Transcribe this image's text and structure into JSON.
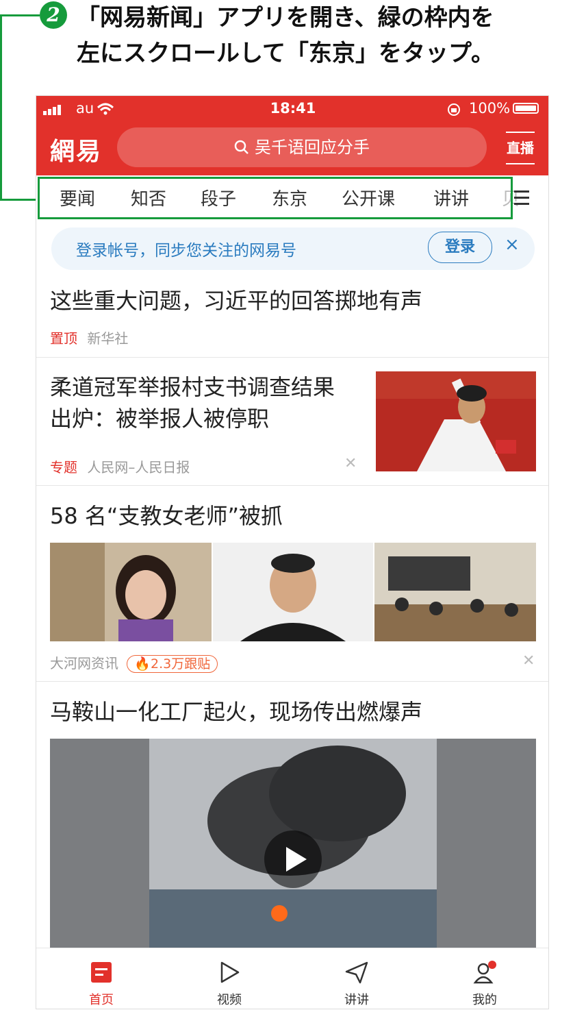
{
  "instruction": {
    "step": "2",
    "line1": "「网易新闻」アプリを開き、緑の枠内を",
    "line2": "左にスクロールして「东京」をタップ。"
  },
  "status_bar": {
    "carrier": "au",
    "time": "18:41",
    "battery": "100%"
  },
  "header": {
    "logo": "網易",
    "search_placeholder": "吴千语回应分手",
    "live_label": "直播"
  },
  "tabs": [
    "要闻",
    "知否",
    "段子",
    "东京",
    "公开课",
    "讲讲",
    "贝"
  ],
  "login_banner": {
    "text": "登录帐号，同步您关注的网易号",
    "button": "登录",
    "close": "×"
  },
  "news": [
    {
      "title": "这些重大问题，习近平的回答掷地有声",
      "tag": "置顶",
      "source": "新华社"
    },
    {
      "title_line1": "柔道冠军举报村支书调查结果",
      "title_line2": "出炉：被举报人被停职",
      "tag": "专题",
      "source": "人民网–人民日报"
    },
    {
      "title": "58 名“支教女老师”被抓",
      "source": "大河网资讯",
      "comments": "2.3万跟贴"
    },
    {
      "title": "马鞍山一化工厂起火，现场传出燃爆声"
    }
  ],
  "bottom_nav": {
    "home": "首页",
    "video": "视频",
    "talk": "讲讲",
    "mine": "我的"
  },
  "colors": {
    "brand_red": "#e2312b",
    "highlight_green": "#169b3c",
    "link_blue": "#2a7bbf"
  }
}
